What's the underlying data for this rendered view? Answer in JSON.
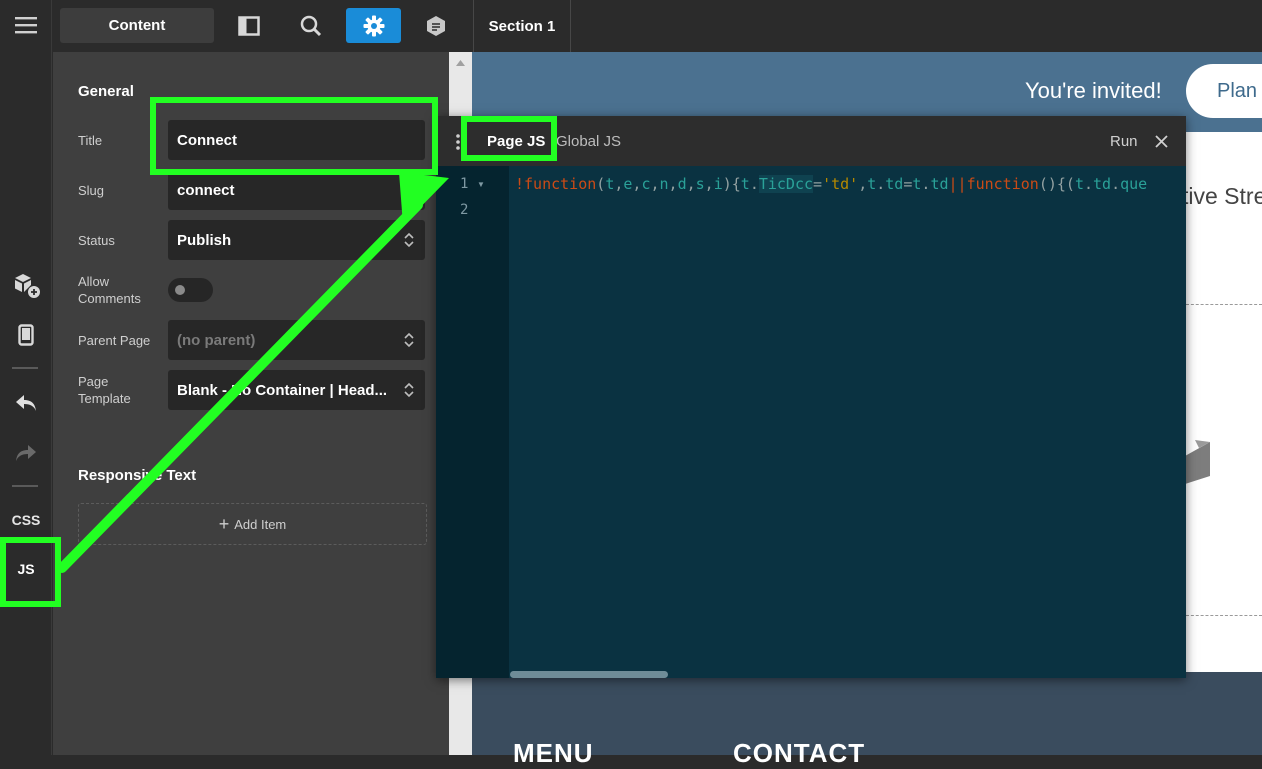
{
  "rail": {
    "css_label": "CSS",
    "js_label": "JS"
  },
  "topbar": {
    "content_tab": "Content",
    "section_tab": "Section 1"
  },
  "panel": {
    "heading": "General",
    "fields": {
      "title_label": "Title",
      "title_value": "Connect",
      "slug_label": "Slug",
      "slug_value": "connect",
      "status_label": "Status",
      "status_value": "Publish",
      "comments_label": "Allow Comments",
      "parent_label": "Parent Page",
      "parent_value": "(no parent)",
      "template_label": "Page Template",
      "template_value": "Blank - No Container | Head..."
    },
    "responsive_heading": "Responsive Text",
    "add_item": "Add Item"
  },
  "preview": {
    "banner_text": "You're invited!",
    "plan_button": "Plan ...",
    "body_text": "tive Stre",
    "footer_menu": "MENU",
    "footer_contact": "CONTACT"
  },
  "editor": {
    "tab_page": "Page JS",
    "tab_global": "Global JS",
    "run": "Run",
    "line1": "1",
    "line2": "2"
  },
  "colors": {
    "highlight": "#22ff22",
    "accent_blue": "#1a8cd8",
    "editor_bg": "#0a3241"
  }
}
